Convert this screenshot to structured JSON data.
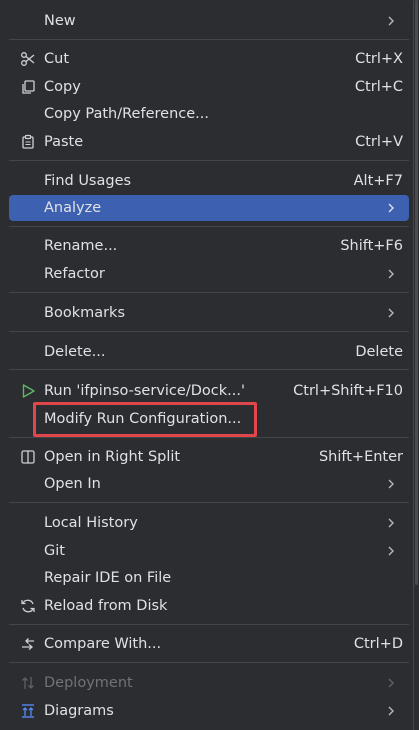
{
  "menu": {
    "new": {
      "label": "New"
    },
    "cut": {
      "label": "Cut",
      "shortcut": "Ctrl+X",
      "icon": "scissors-icon"
    },
    "copy": {
      "label": "Copy",
      "shortcut": "Ctrl+C",
      "icon": "copy-icon"
    },
    "copy_path": {
      "label": "Copy Path/Reference..."
    },
    "paste": {
      "label": "Paste",
      "shortcut": "Ctrl+V",
      "icon": "clipboard-icon"
    },
    "find_usages": {
      "label": "Find Usages",
      "shortcut": "Alt+F7"
    },
    "analyze": {
      "label": "Analyze"
    },
    "rename": {
      "label": "Rename...",
      "shortcut": "Shift+F6"
    },
    "refactor": {
      "label": "Refactor"
    },
    "bookmarks": {
      "label": "Bookmarks"
    },
    "delete": {
      "label": "Delete...",
      "shortcut": "Delete"
    },
    "run": {
      "label": "Run 'ifpinso-service/Dock...'",
      "shortcut": "Ctrl+Shift+F10",
      "icon": "run-play-icon"
    },
    "modify_run": {
      "label": "Modify Run Configuration..."
    },
    "open_right_split": {
      "label": "Open in Right Split",
      "shortcut": "Shift+Enter",
      "icon": "split-view-icon"
    },
    "open_in": {
      "label": "Open In"
    },
    "local_history": {
      "label": "Local History"
    },
    "git": {
      "label": "Git"
    },
    "repair_ide": {
      "label": "Repair IDE on File"
    },
    "reload": {
      "label": "Reload from Disk",
      "icon": "reload-icon"
    },
    "compare": {
      "label": "Compare With...",
      "shortcut": "Ctrl+D",
      "icon": "compare-arrows-icon"
    },
    "deployment": {
      "label": "Deployment",
      "icon": "deployment-icon"
    },
    "diagrams": {
      "label": "Diagrams",
      "icon": "diagram-icon"
    }
  },
  "colors": {
    "background": "#2b2d30",
    "selected": "#3d61b0",
    "separator": "#43454a",
    "highlight_border": "#e0464a",
    "run_icon": "#5fb865"
  }
}
